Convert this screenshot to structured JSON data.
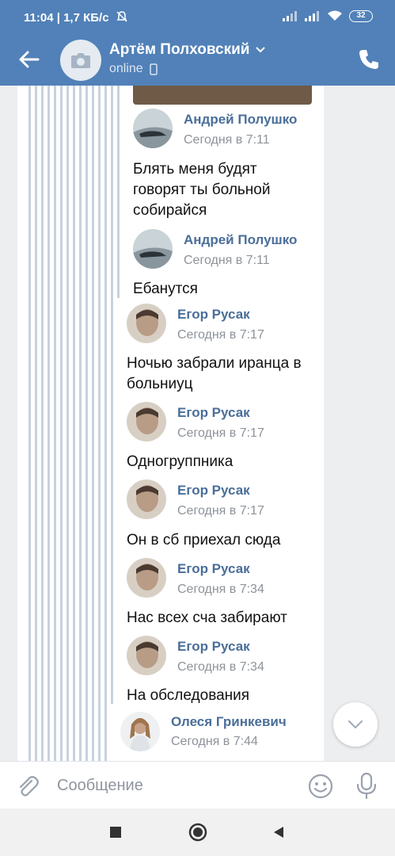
{
  "status_bar": {
    "time": "11:04",
    "network_speed": "| 1,7 КБ/с",
    "battery": "32"
  },
  "header": {
    "title": "Артём Полховский",
    "status": "online"
  },
  "messages": [
    {
      "name": "Андрей Полушко",
      "time": "Сегодня в 7:11",
      "text": "Блять меня будят говорят ты больной собирайся",
      "avatar": "car-avatar"
    },
    {
      "name": "Андрей Полушко",
      "time": "Сегодня в 7:11",
      "text": "Ебанутся",
      "avatar": "car-avatar"
    },
    {
      "name": "Егор Русак",
      "time": "Сегодня в 7:17",
      "text": "Ночью забрали иранца в больниуц",
      "avatar": "face-avatar"
    },
    {
      "name": "Егор Русак",
      "time": "Сегодня в 7:17",
      "text": "Одногруппника",
      "avatar": "face-avatar"
    },
    {
      "name": "Егор Русак",
      "time": "Сегодня в 7:17",
      "text": "Он в сб приехал сюда",
      "avatar": "face-avatar"
    },
    {
      "name": "Егор Русак",
      "time": "Сегодня в 7:34",
      "text": "Нас всех сча забирают",
      "avatar": "face-avatar"
    },
    {
      "name": "Егор Русак",
      "time": "Сегодня в 7:34",
      "text": "На обследования",
      "avatar": "face-avatar"
    },
    {
      "name": "Олеся Гринкевич",
      "time": "Сегодня в 7:44",
      "text": "",
      "avatar": "person-avatar"
    }
  ],
  "composer": {
    "placeholder": "Сообщение"
  },
  "colors": {
    "header_bg": "#5181b8",
    "name_color": "#4a6e99",
    "time_color": "#8d939a",
    "thread_line": "#c7d2de"
  }
}
